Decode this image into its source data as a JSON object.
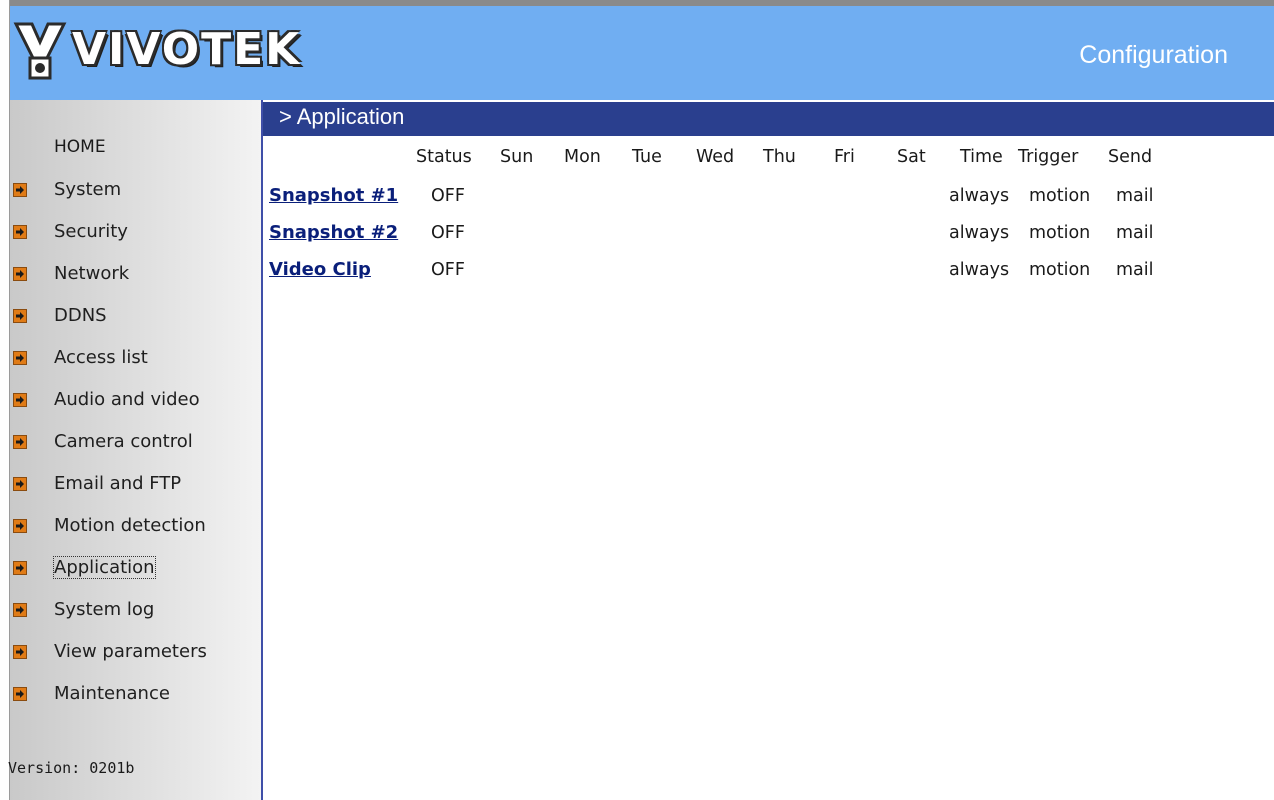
{
  "header": {
    "logo_text": "VIVOTEK",
    "title": "Configuration"
  },
  "sidebar": {
    "home_label": "HOME",
    "items": [
      {
        "label": "System"
      },
      {
        "label": "Security"
      },
      {
        "label": "Network"
      },
      {
        "label": "DDNS"
      },
      {
        "label": "Access list"
      },
      {
        "label": "Audio and video"
      },
      {
        "label": "Camera control"
      },
      {
        "label": "Email and FTP"
      },
      {
        "label": "Motion detection"
      },
      {
        "label": "Application",
        "active": true
      },
      {
        "label": "System log"
      },
      {
        "label": "View parameters"
      },
      {
        "label": "Maintenance"
      }
    ],
    "version": "Version: 0201b"
  },
  "section": {
    "title": "> Application"
  },
  "table": {
    "columns": [
      "Status",
      "Sun",
      "Mon",
      "Tue",
      "Wed",
      "Thu",
      "Fri",
      "Sat",
      "Time",
      "Trigger",
      "Send"
    ],
    "rows": [
      {
        "name": "Snapshot #1",
        "status": "OFF",
        "time": "always",
        "trigger": "motion",
        "send": "mail"
      },
      {
        "name": "Snapshot #2",
        "status": "OFF",
        "time": "always",
        "trigger": "motion",
        "send": "mail"
      },
      {
        "name": "Video Clip",
        "status": "OFF",
        "time": "always",
        "trigger": "motion",
        "send": "mail"
      }
    ]
  },
  "colors": {
    "header_bg": "#70aef2",
    "section_bar": "#2a3f8e",
    "link": "#0a1f7a",
    "arrow_icon": "#e07b16"
  },
  "icons": {
    "logo": "vivotek-logo",
    "menu_bullet": "arrow-right-icon"
  }
}
